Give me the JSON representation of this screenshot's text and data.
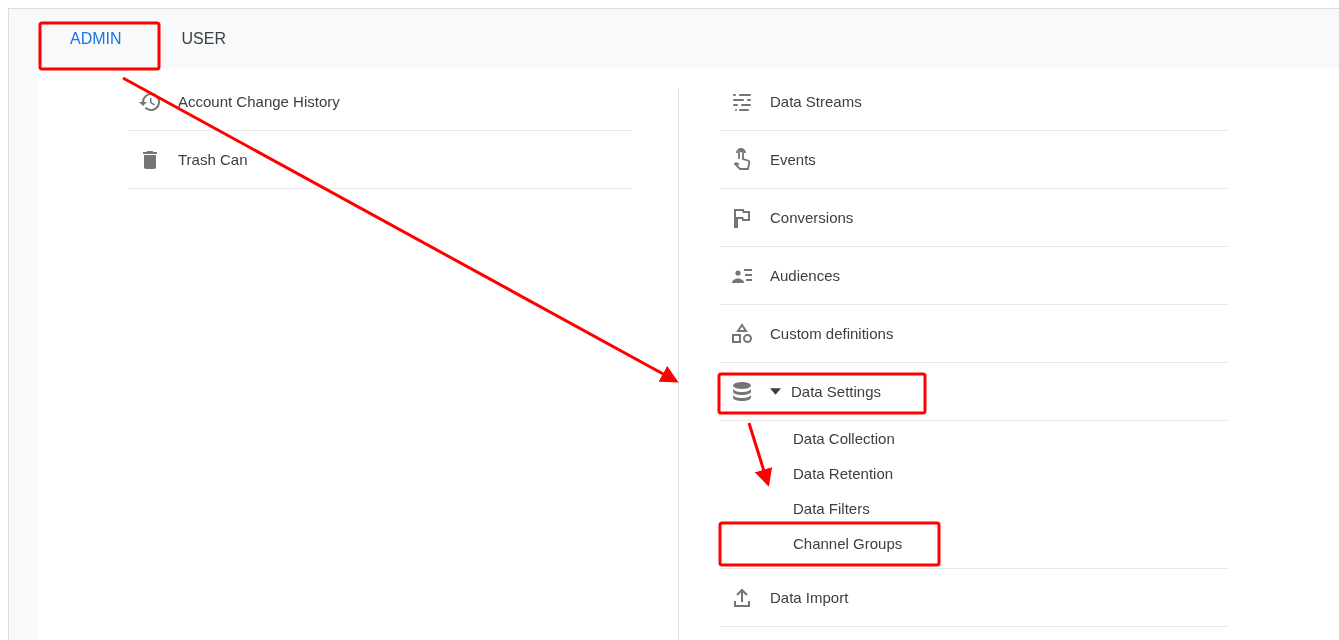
{
  "tabs": [
    {
      "label": "ADMIN",
      "selected": true
    },
    {
      "label": "USER",
      "selected": false
    }
  ],
  "left_items": [
    {
      "label": "Account Change History"
    },
    {
      "label": "Trash Can"
    }
  ],
  "right_items": [
    {
      "label": "Data Streams",
      "kind": "link"
    },
    {
      "label": "Events",
      "kind": "link"
    },
    {
      "label": "Conversions",
      "kind": "link"
    },
    {
      "label": "Audiences",
      "kind": "link"
    },
    {
      "label": "Custom definitions",
      "kind": "link"
    },
    {
      "label": "Data Settings",
      "kind": "group",
      "expanded": true,
      "children": [
        {
          "label": "Data Collection"
        },
        {
          "label": "Data Retention"
        },
        {
          "label": "Data Filters"
        },
        {
          "label": "Channel Groups"
        }
      ]
    },
    {
      "label": "Data Import",
      "kind": "link"
    }
  ]
}
